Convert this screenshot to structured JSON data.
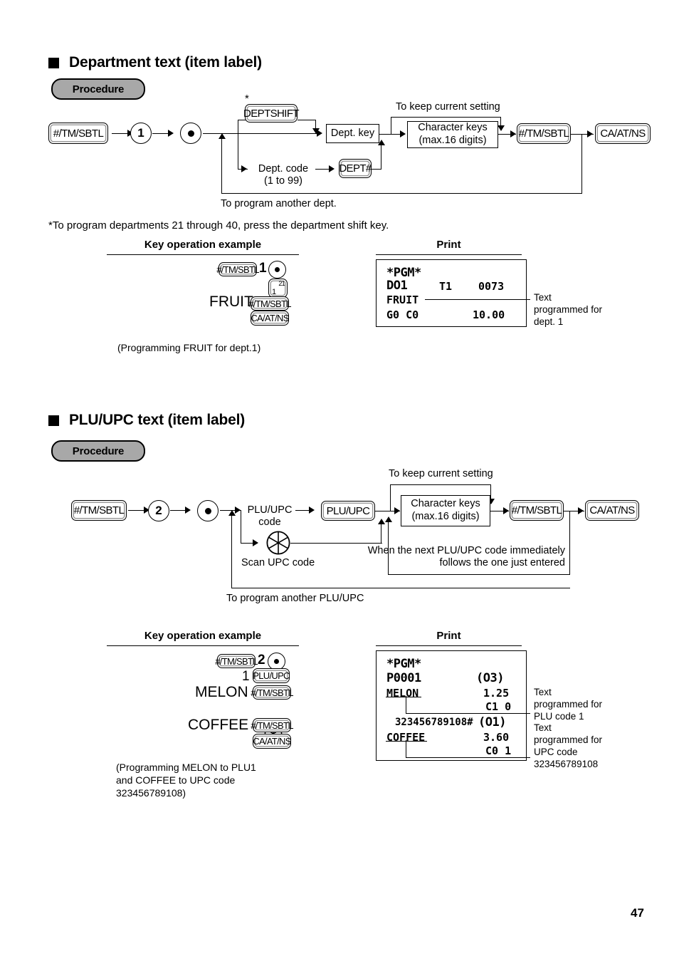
{
  "page": {
    "number": "47"
  },
  "sections": [
    {
      "id": "department-text",
      "title": "Department text (item label)",
      "procedure_label": "Procedure",
      "flow": {
        "start_key": "#/TM/SBTL",
        "mode_digit": "1",
        "dept_shift_key": "DEPTSHIFT",
        "dept_shift_asterisk": "*",
        "dept_code_label": "Dept. code",
        "dept_code_range": "(1 to 99)",
        "dept_hash_key": "DEPT#",
        "dept_key_box": "Dept. key",
        "keep_setting_label": "To keep current setting",
        "char_keys_line1": "Character keys",
        "char_keys_line2": "(max.16 digits)",
        "finish_key": "#/TM/SBTL",
        "cash_key": "CA/AT/NS",
        "loop_label": "To program another dept."
      },
      "footnote": "*To program departments 21 through 40, press the department shift key.",
      "example": {
        "header": "Key operation example",
        "rows": [
          {
            "text": "",
            "keys": [
              "#/TM/SBTL"
            ],
            "digit": "1",
            "circle_dot": true
          },
          {
            "text": "",
            "dept_key": {
              "top_right": "21",
              "bottom_left": "1"
            }
          },
          {
            "text": "FRUIT",
            "keys": [
              "#/TM/SBTL"
            ]
          },
          {
            "text": "",
            "keys": [
              "CA/AT/NS"
            ]
          }
        ],
        "caption": "(Programming FRUIT for dept.1)"
      },
      "print": {
        "header": "Print",
        "lines": [
          {
            "left": "*PGM*",
            "mid": "",
            "right": ""
          },
          {
            "left": "DO1",
            "mid": "T1",
            "right": "0073"
          },
          {
            "left": "FRUIT",
            "mid": "",
            "right": ""
          },
          {
            "left": "G0 C0",
            "mid": "",
            "right": "10.00"
          }
        ],
        "callouts": [
          {
            "text": "Text\nprogrammed for\ndept. 1"
          }
        ]
      }
    },
    {
      "id": "plu-upc-text",
      "title": "PLU/UPC text (item label)",
      "procedure_label": "Procedure",
      "flow": {
        "start_key": "#/TM/SBTL",
        "mode_digit": "2",
        "plu_code_line1": "PLU/UPC",
        "plu_code_line2": "code",
        "plu_key": "PLU/UPC",
        "scan_label": "Scan UPC code",
        "scan_icon": "scan-upc-icon",
        "keep_setting_label": "To keep current setting",
        "char_keys_line1": "Character keys",
        "char_keys_line2": "(max.16 digits)",
        "finish_key": "#/TM/SBTL",
        "cash_key": "CA/AT/NS",
        "next_code_line1": "When the next PLU/UPC code immediately",
        "next_code_line2": "follows the one just entered",
        "loop_label": "To program another PLU/UPC"
      },
      "example": {
        "header": "Key operation example",
        "rows": [
          {
            "text": "",
            "keys": [
              "#/TM/SBTL"
            ],
            "digit": "2",
            "circle_dot": true
          },
          {
            "text": "1",
            "keys": [
              "PLU/UPC"
            ]
          },
          {
            "text": "MELON",
            "keys": [
              "#/TM/SBTL"
            ]
          },
          {
            "text": "",
            "scan": true
          },
          {
            "text": "COFFEE",
            "keys": [
              "#/TM/SBTL"
            ]
          },
          {
            "text": "",
            "keys": [
              "CA/AT/NS"
            ]
          }
        ],
        "caption_line1": "(Programming MELON to PLU1",
        "caption_line2": "and COFFEE to UPC code",
        "caption_line3": "323456789108)"
      },
      "print": {
        "header": "Print",
        "lines": [
          {
            "left": "*PGM*",
            "right": ""
          },
          {
            "left": "P0001",
            "right": "(O3)"
          },
          {
            "left": "MELON",
            "right": "1.25"
          },
          {
            "left": "",
            "right": "C1 0"
          },
          {
            "left": "323456789108#",
            "right": "(O1)"
          },
          {
            "left": "COFFEE",
            "right": "3.60"
          },
          {
            "left": "",
            "right": "C0 1"
          }
        ],
        "callouts": [
          {
            "text": "Text\nprogrammed for\nPLU code 1"
          },
          {
            "text": "Text\nprogrammed for\nUPC code\n323456789108"
          }
        ]
      }
    }
  ]
}
